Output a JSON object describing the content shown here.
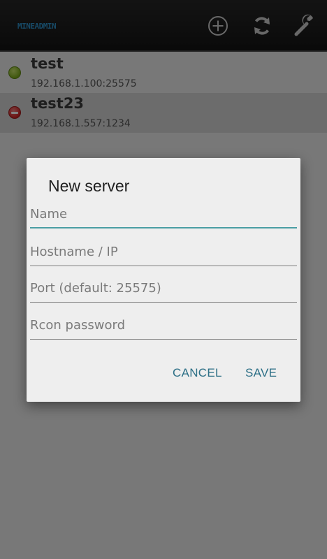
{
  "app": {
    "logo": "MINEADMIN"
  },
  "actionbar": {
    "icons": [
      "add-icon",
      "refresh-icon",
      "wrench-icon"
    ]
  },
  "servers": [
    {
      "name": "test",
      "address": "192.168.1.100:25575",
      "status": "online",
      "status_color": "#7aa81c"
    },
    {
      "name": "test23",
      "address": "192.168.1.557:1234",
      "status": "offline",
      "status_color": "#cc2222"
    }
  ],
  "dialog": {
    "title": "New server",
    "fields": {
      "name": {
        "value": "",
        "placeholder": "Name"
      },
      "host": {
        "value": "",
        "placeholder": "Hostname / IP"
      },
      "port": {
        "value": "",
        "placeholder": "Port (default: 25575)"
      },
      "rcon": {
        "value": "",
        "placeholder": "Rcon password"
      }
    },
    "cancel_label": "CANCEL",
    "save_label": "SAVE"
  },
  "colors": {
    "accent": "#4a9ea4",
    "button_text": "#2c6f86",
    "logo": "#2d8fc6"
  }
}
